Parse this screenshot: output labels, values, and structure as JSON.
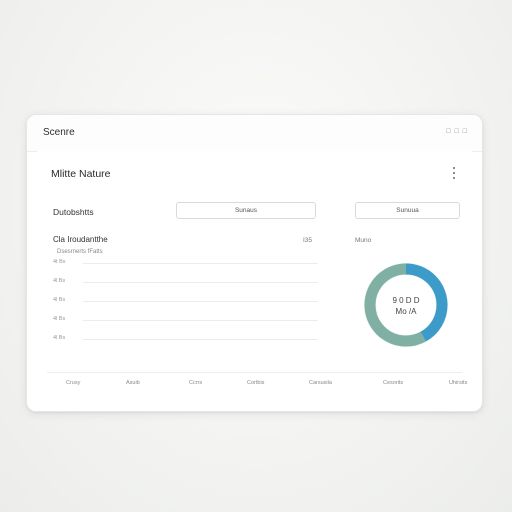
{
  "app": {
    "title": "Scenre",
    "controls": "□ □ □"
  },
  "card": {
    "title": "Mlitte Nature",
    "section_label": "Dutobshtts",
    "button_left": "Sunaus",
    "button_right": "Sunuua",
    "chart_title": "Cla Iroudantthe",
    "chart_subtitle": "Dsesrnerts fFatts",
    "chart_value": "I35",
    "donut_title": "Muno",
    "donut_center_line1": "9 0 D D",
    "donut_center_line2": "Mo /A"
  },
  "chart_data": {
    "type": "line",
    "title": "Cla Iroudantthe",
    "y_ticks": [
      "4t Bs",
      "4l Bs",
      "4l Bs",
      "4l Bs",
      "4l Bs"
    ],
    "x_labels": [
      "Crusy",
      "Asuib",
      "Ccrrs",
      "Cortbis",
      "Carsusila",
      "Cesorits",
      "Uhirsits"
    ],
    "series": []
  },
  "donut_chart": {
    "type": "pie",
    "values": [
      42,
      58
    ],
    "colors": [
      "#3c9bc9",
      "#7fb0a3"
    ]
  },
  "colors": {
    "accent_blue": "#3c9bc9",
    "accent_teal": "#7fb0a3"
  }
}
